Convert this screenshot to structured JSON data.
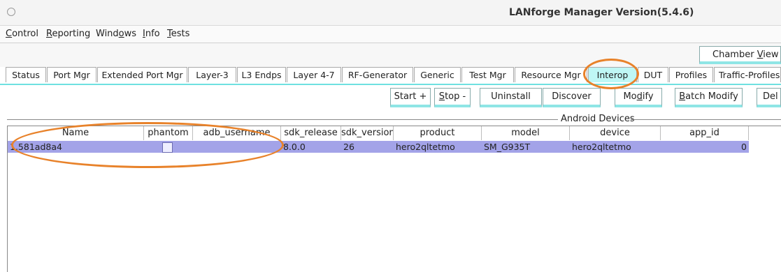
{
  "window": {
    "title": "LANforge Manager   Version(5.4.6)"
  },
  "menu": [
    {
      "pre": "",
      "u": "C",
      "post": "ontrol"
    },
    {
      "pre": "",
      "u": "R",
      "post": "eporting"
    },
    {
      "pre": "Wind",
      "u": "o",
      "post": "ws"
    },
    {
      "pre": "",
      "u": "I",
      "post": "nfo"
    },
    {
      "pre": "",
      "u": "T",
      "post": "ests"
    }
  ],
  "chamber_view": {
    "pre": "Chamber ",
    "u": "V",
    "post": "iew"
  },
  "tabs": [
    "Status",
    "Port Mgr",
    "Extended Port Mgr",
    "Layer-3",
    "L3 Endps",
    "Layer 4-7",
    "RF-Generator",
    "Generic",
    "Test Mgr",
    "Resource Mgr",
    "Interop",
    "DUT",
    "Profiles",
    "Traffic-Profiles"
  ],
  "active_tab": "Interop",
  "toolbar": {
    "start": "Start +",
    "stop": {
      "pre": "",
      "u": "S",
      "post": "top -"
    },
    "uninstall": "Uninstall",
    "discover": "Discover",
    "modify": {
      "pre": "Mo",
      "u": "d",
      "post": "ify"
    },
    "batch_modify": {
      "pre": "",
      "u": "B",
      "post": "atch Modify"
    },
    "delete": "Del"
  },
  "group_title": "Android Devices",
  "table": {
    "columns": [
      "Name",
      "phantom",
      "adb_username",
      "sdk_release",
      "sdk_version",
      "product",
      "model",
      "device",
      "app_id"
    ],
    "rows": [
      {
        "name": "1.581ad8a4",
        "phantom": false,
        "adb_username": "",
        "sdk_release": "8.0.0",
        "sdk_version": "26",
        "product": "hero2qltetmo",
        "model": "SM_G935T",
        "device": "hero2qltetmo",
        "app_id": "0"
      }
    ]
  },
  "accent_color": "#6fe0e0",
  "highlight_color": "#e8822a",
  "selected_row_color": "#a3a3e8"
}
